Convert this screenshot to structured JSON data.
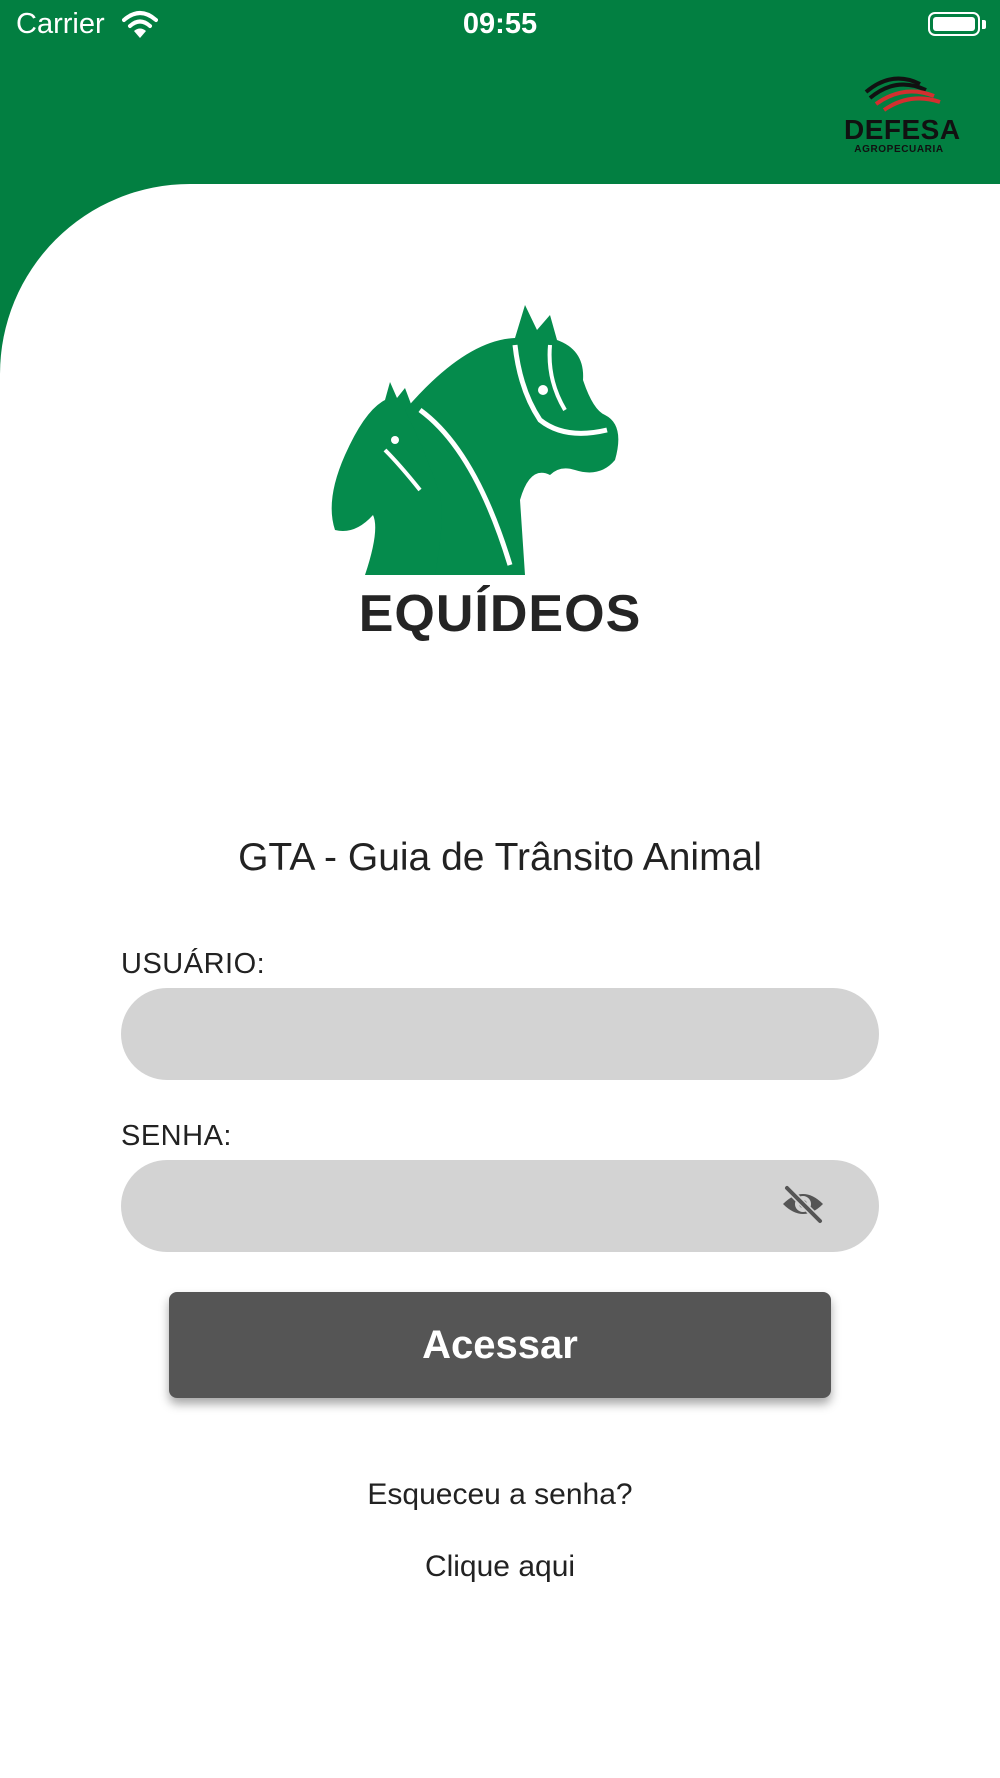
{
  "status_bar": {
    "carrier": "Carrier",
    "time": "09:55"
  },
  "brand": {
    "name": "DEFESA",
    "subname": "AGROPECUARIA"
  },
  "app": {
    "title": "EQUÍDEOS",
    "subtitle": "GTA - Guia de Trânsito Animal"
  },
  "form": {
    "username": {
      "label": "USUÁRIO:",
      "value": "",
      "placeholder": ""
    },
    "password": {
      "label": "SENHA:",
      "value": "",
      "placeholder": "",
      "toggle_icon": "eye-off-icon"
    },
    "submit_label": "Acessar"
  },
  "forgot": {
    "question": "Esqueceu a senha?",
    "link": "Clique aqui"
  },
  "colors": {
    "primary_green": "#027f41",
    "field_bg": "#d3d3d3",
    "button_bg": "#555555",
    "brand_red": "#d32f2f"
  }
}
